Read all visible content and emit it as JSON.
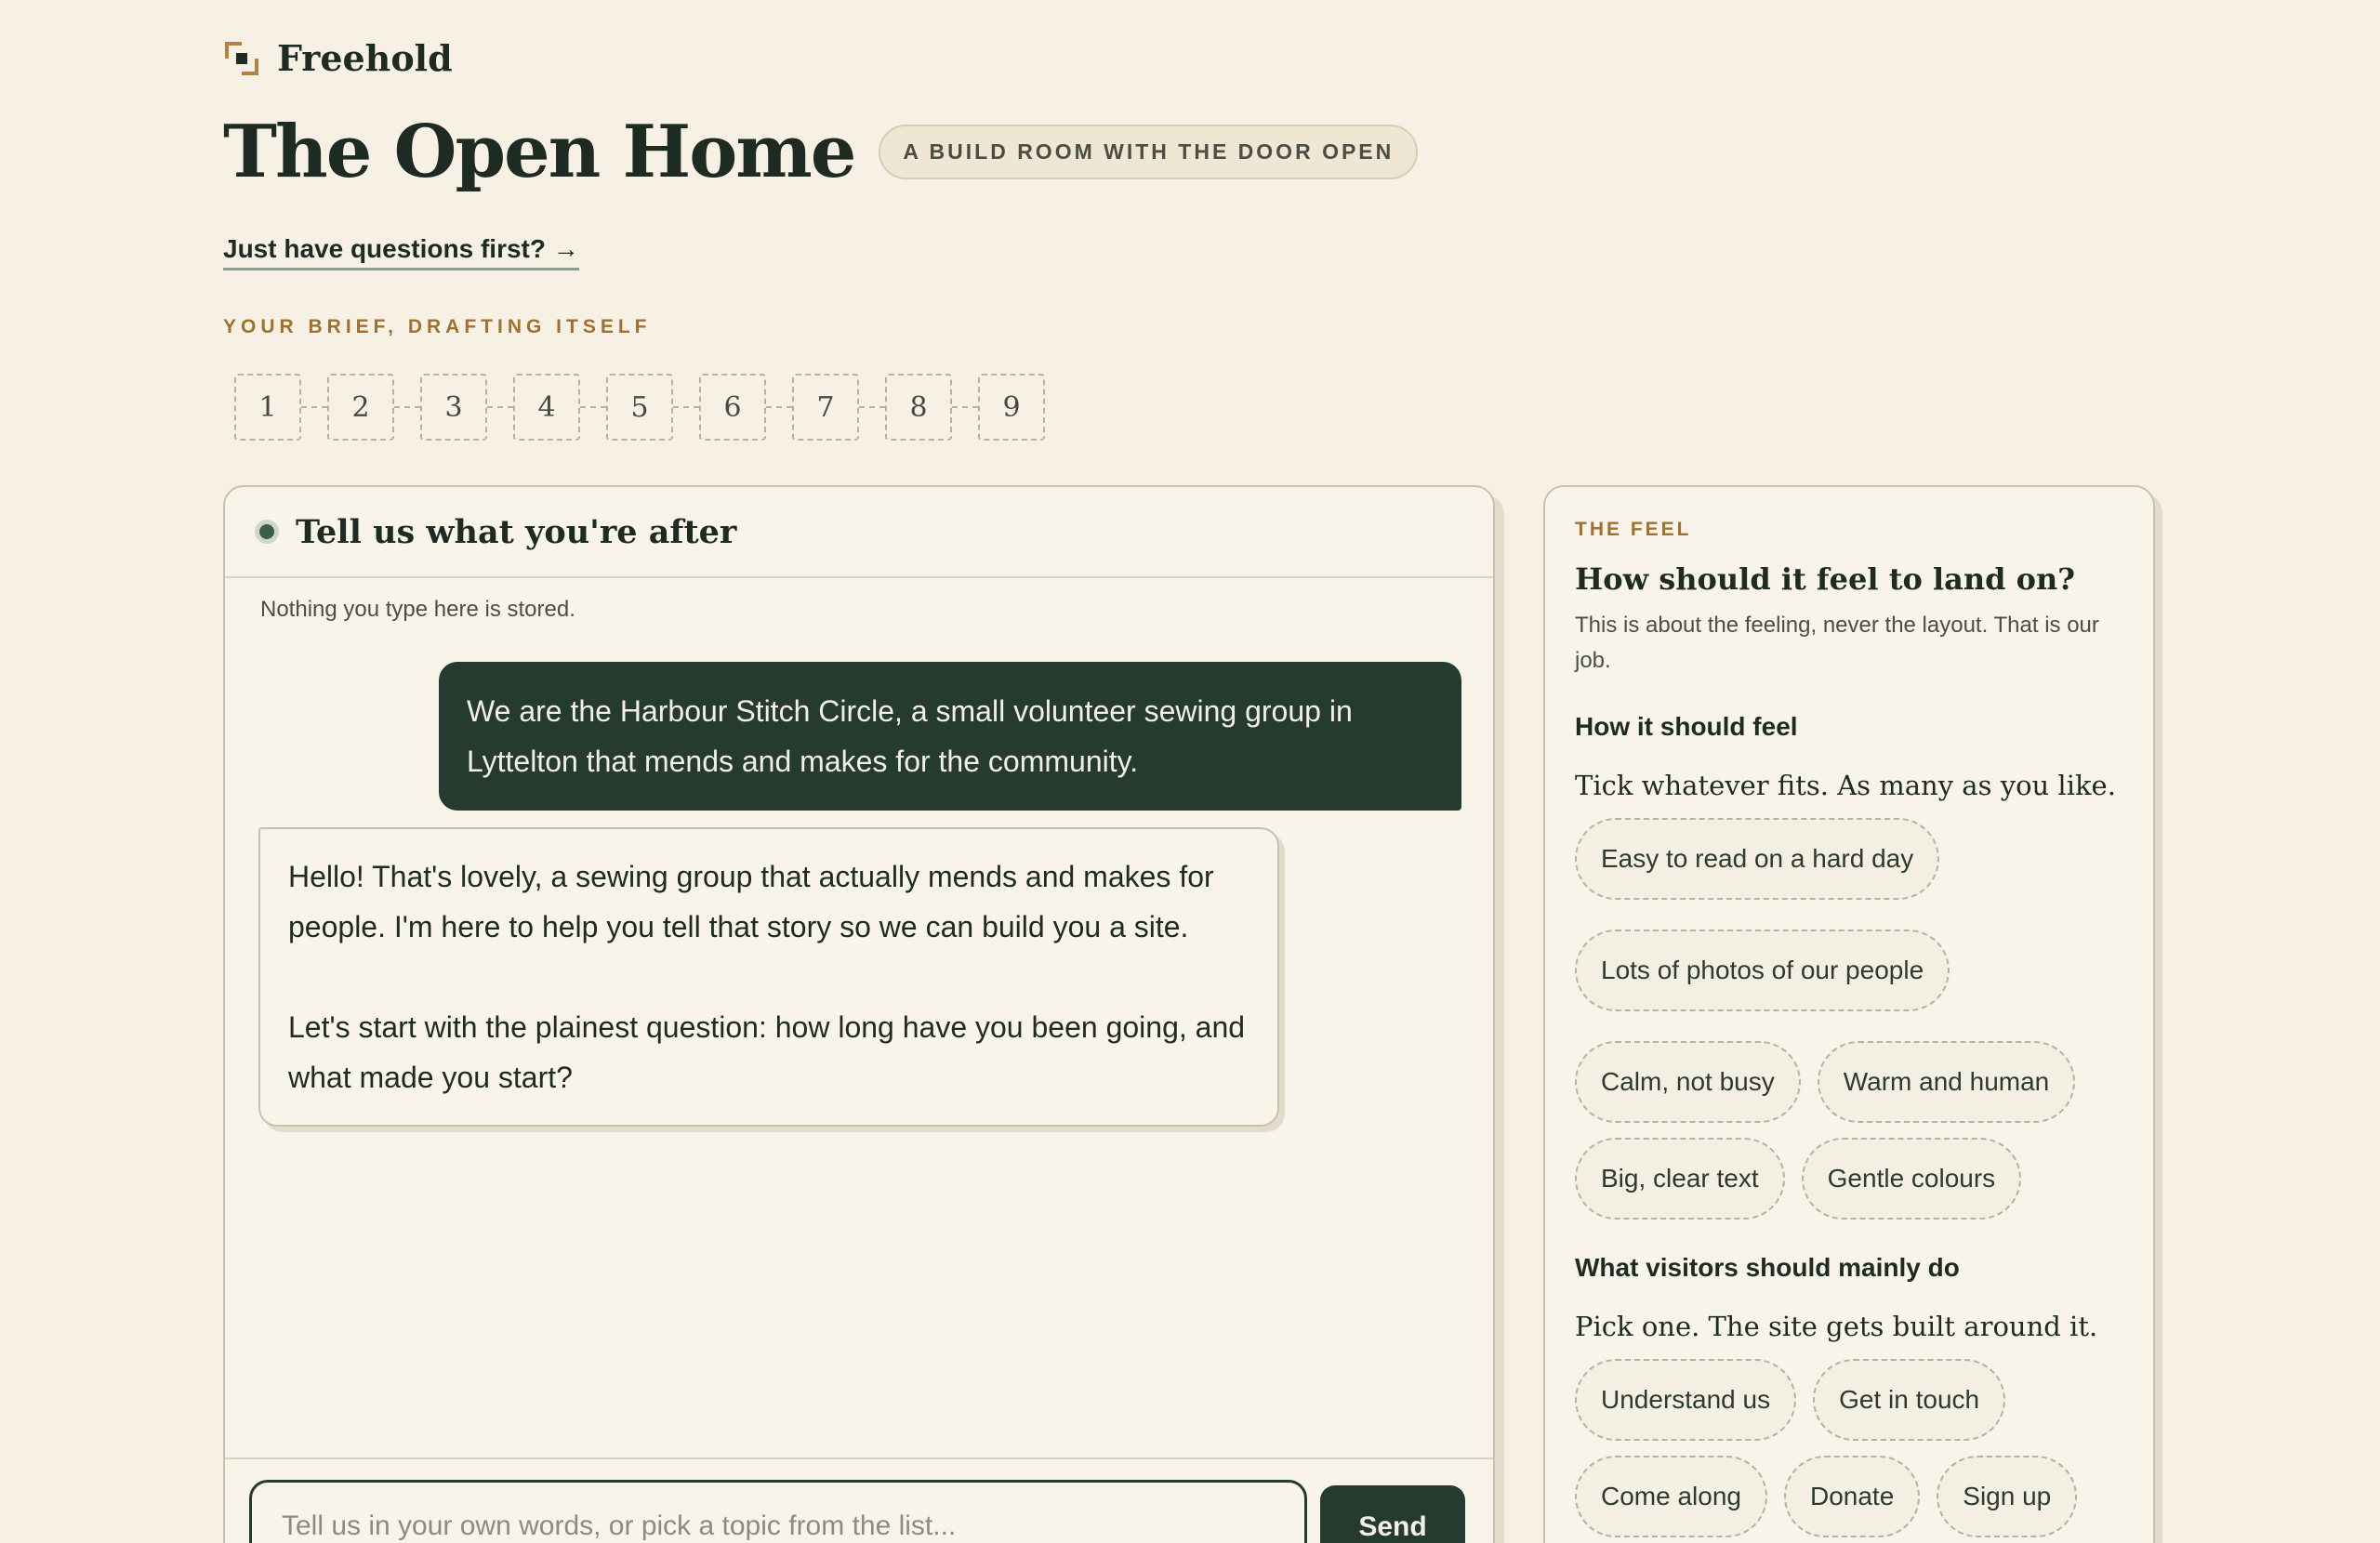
{
  "brand": {
    "name": "Freehold"
  },
  "page": {
    "title": "The Open Home",
    "tagline": "A BUILD ROOM WITH THE DOOR OPEN",
    "questions_link": "Just have questions first? →",
    "brief_label": "YOUR BRIEF, DRAFTING ITSELF",
    "steps": [
      "1",
      "2",
      "3",
      "4",
      "5",
      "6",
      "7",
      "8",
      "9"
    ]
  },
  "chat": {
    "title": "Tell us what you're after",
    "privacy_note": "Nothing you type here is stored.",
    "user_message": "We are the Harbour Stitch Circle, a small volunteer sewing group in Lyttelton that mends and makes for the community.",
    "bot_message_p1": "Hello! That's lovely, a sewing group that actually mends and makes for people. I'm here to help you tell that story so we can build you a site.",
    "bot_message_p2": "Let's start with the plainest question: how long have you been going, and what made you start?",
    "input_placeholder": "Tell us in your own words, or pick a topic from the list...",
    "send_label": "Send"
  },
  "feel": {
    "eyebrow": "THE FEEL",
    "heading": "How should it feel to land on?",
    "sub": "This is about the feeling, never the layout. That is our job.",
    "feel_group_title": "How it should feel",
    "feel_group_hint": "Tick whatever fits. As many as you like.",
    "feel_chips": [
      "Easy to read on a hard day",
      "Lots of photos of our people",
      "Calm, not busy",
      "Warm and human",
      "Big, clear text",
      "Gentle colours"
    ],
    "do_group_title": "What visitors should mainly do",
    "do_group_hint": "Pick one. The site gets built around it.",
    "do_chips": [
      "Understand us",
      "Get in touch",
      "Come along",
      "Donate",
      "Sign up"
    ]
  },
  "colors": {
    "background": "#f7f1e5",
    "dark_green": "#253b2f",
    "accent_ochre": "#a0712e"
  }
}
